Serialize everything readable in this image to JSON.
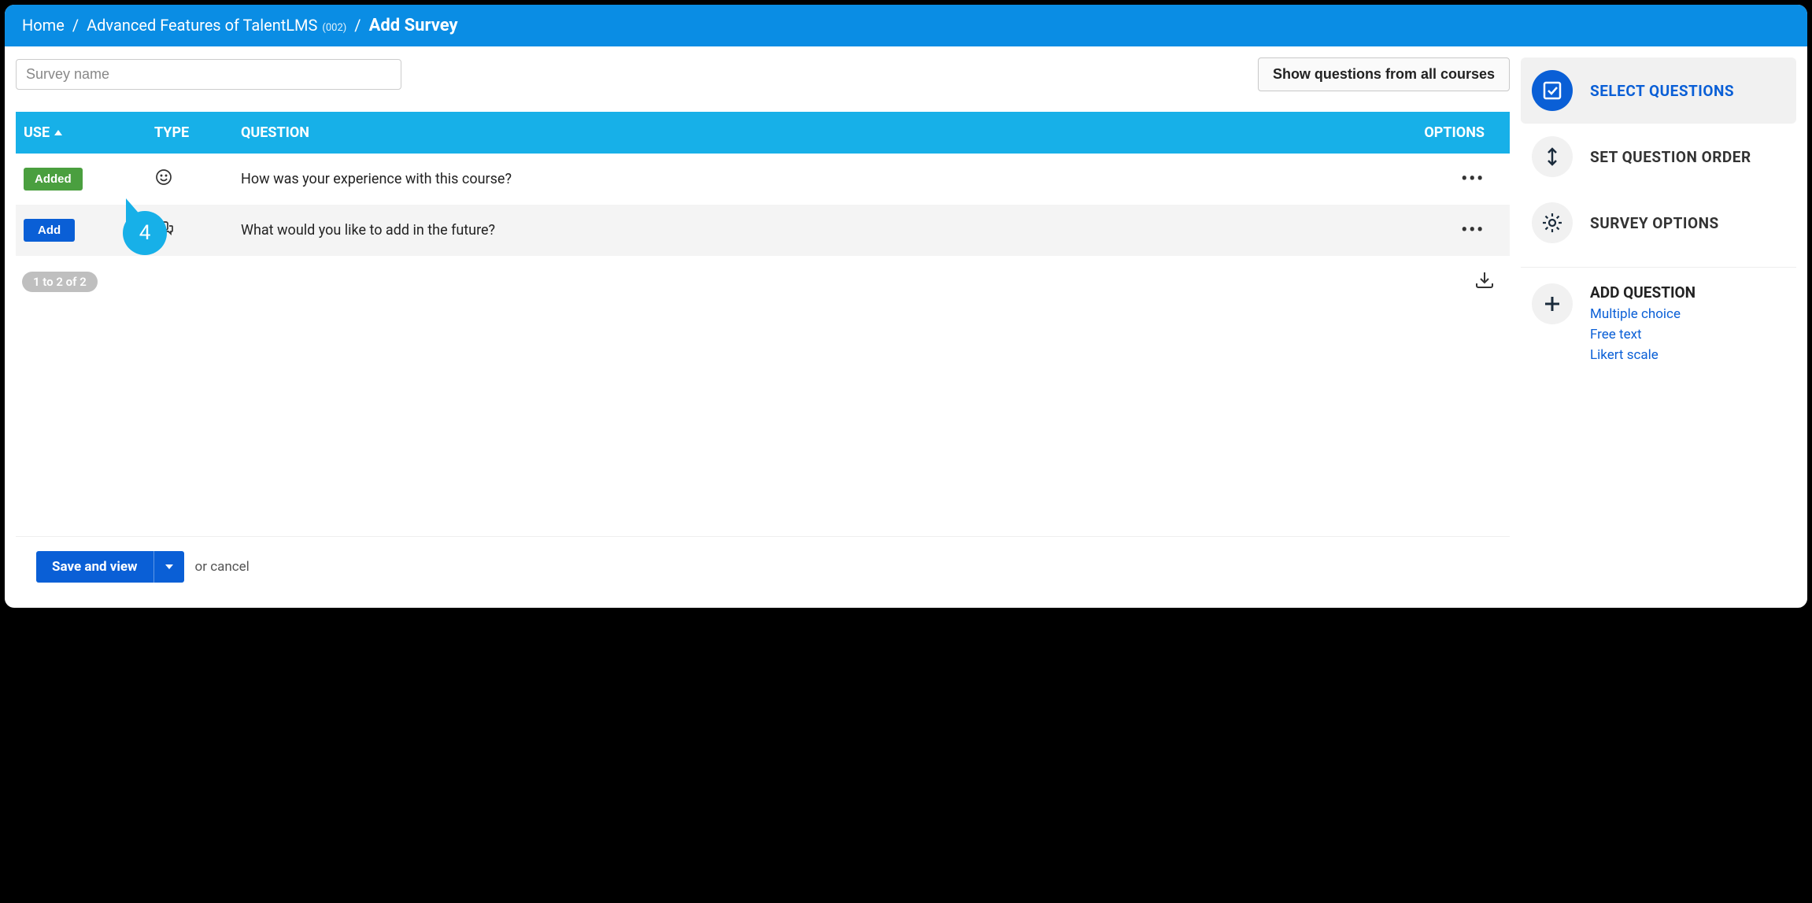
{
  "breadcrumb": {
    "home": "Home",
    "course": "Advanced Features of TalentLMS",
    "course_code": "(002)",
    "current": "Add Survey"
  },
  "toolbar": {
    "survey_name_placeholder": "Survey name",
    "show_all_label": "Show questions from all courses"
  },
  "table": {
    "headers": {
      "use": "USE",
      "type": "TYPE",
      "question": "QUESTION",
      "options": "OPTIONS"
    },
    "rows": [
      {
        "use_label": "Added",
        "use_state": "added",
        "type": "likert",
        "question": "How was your experience with this course?"
      },
      {
        "use_label": "Add",
        "use_state": "add",
        "type": "freetext",
        "question": "What would you like to add in the future?"
      }
    ],
    "range": "1 to 2 of 2"
  },
  "callout": {
    "number": "4"
  },
  "footer": {
    "save_label": "Save and view",
    "or_cancel": "or cancel"
  },
  "sidebar": {
    "items": [
      {
        "label": "SELECT QUESTIONS",
        "active": true
      },
      {
        "label": "SET QUESTION ORDER",
        "active": false
      },
      {
        "label": "SURVEY OPTIONS",
        "active": false
      }
    ],
    "add_question": {
      "title": "ADD QUESTION",
      "links": [
        "Multiple choice",
        "Free text",
        "Likert scale"
      ]
    }
  }
}
